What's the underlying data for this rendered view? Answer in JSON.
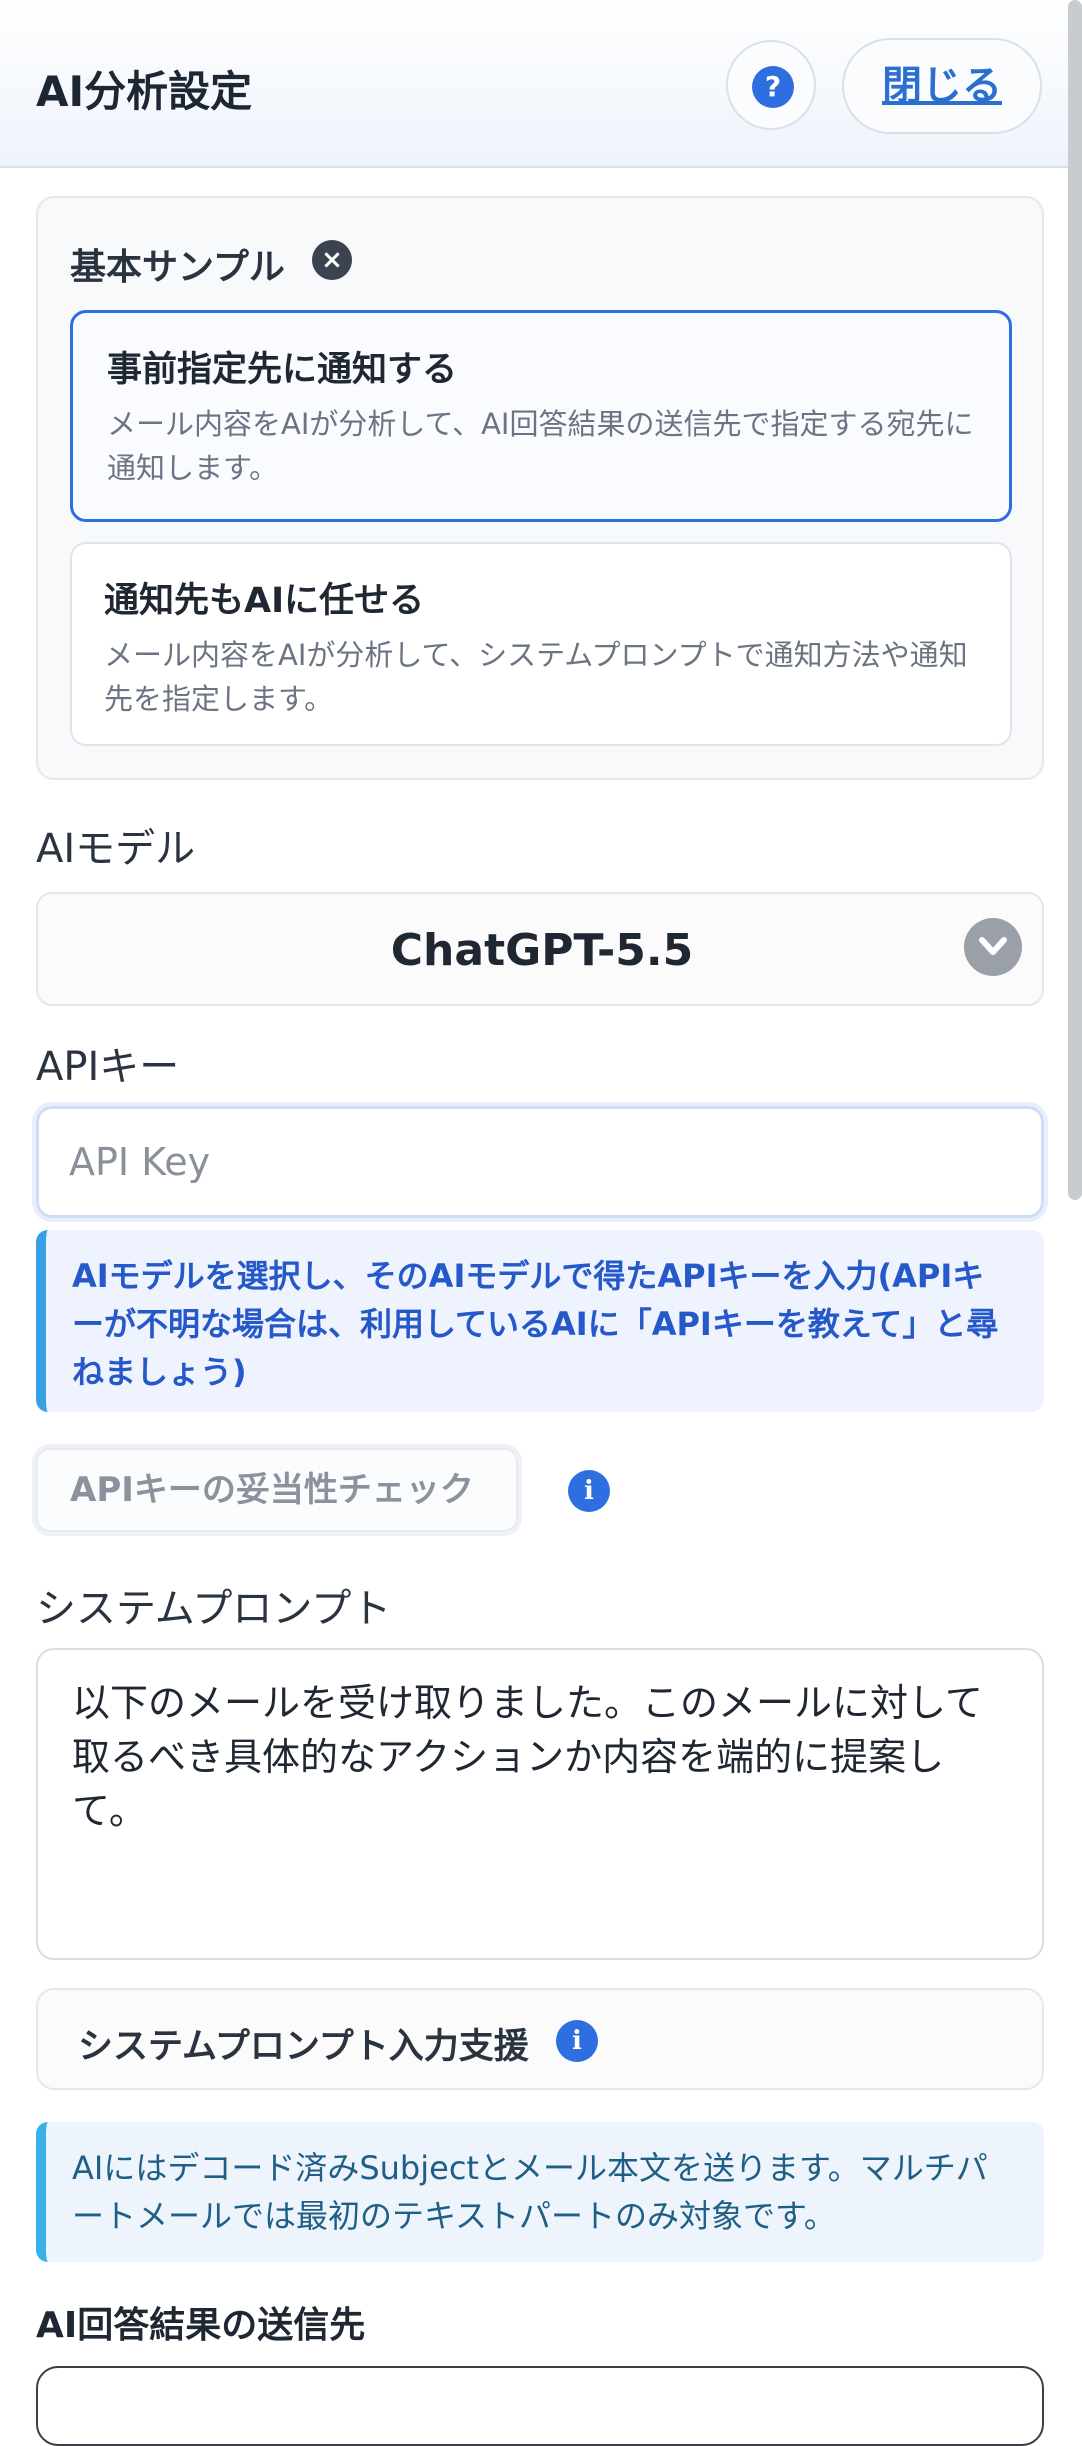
{
  "header": {
    "title": "AI分析設定",
    "help_label": "?",
    "close_label": "閉じる"
  },
  "sample": {
    "title": "基本サンプル",
    "clear_label": "×",
    "options": [
      {
        "title": "事前指定先に通知する",
        "description": "メール内容をAIが分析して、AI回答結果の送信先で指定する宛先に通知します。",
        "selected": true
      },
      {
        "title": "通知先もAIに任せる",
        "description": "メール内容をAIが分析して、システムプロンプトで通知方法や通知先を指定します。",
        "selected": false
      }
    ]
  },
  "model": {
    "label": "AIモデル",
    "value": "ChatGPT-5.5"
  },
  "api_key": {
    "label": "APIキー",
    "placeholder": "API Key",
    "value": "",
    "help_text": "AIモデルを選択し、そのAIモデルで得たAPIキーを入力(APIキーが不明な場合は、利用しているAIに「APIキーを教えて」と尋ねましょう)",
    "check_button_label": "APIキーの妥当性チェック",
    "info_label": "i"
  },
  "system_prompt": {
    "label": "システムプロンプト",
    "value": "以下のメールを受け取りました。このメールに対して取るべき具体的なアクションか内容を端的に提案して。",
    "assist_label": "システムプロンプト入力支援",
    "info_label": "i",
    "note": "AIにはデコード済みSubjectとメール本文を送ります。マルチパートメールでは最初のテキストパートのみ対象です。"
  },
  "result": {
    "label": "AI回答結果の送信先"
  },
  "colors": {
    "accent": "#2f6ee0",
    "info_border": "#3aa0e6",
    "info_text": "#2558c8",
    "link": "#2b6fd0"
  }
}
